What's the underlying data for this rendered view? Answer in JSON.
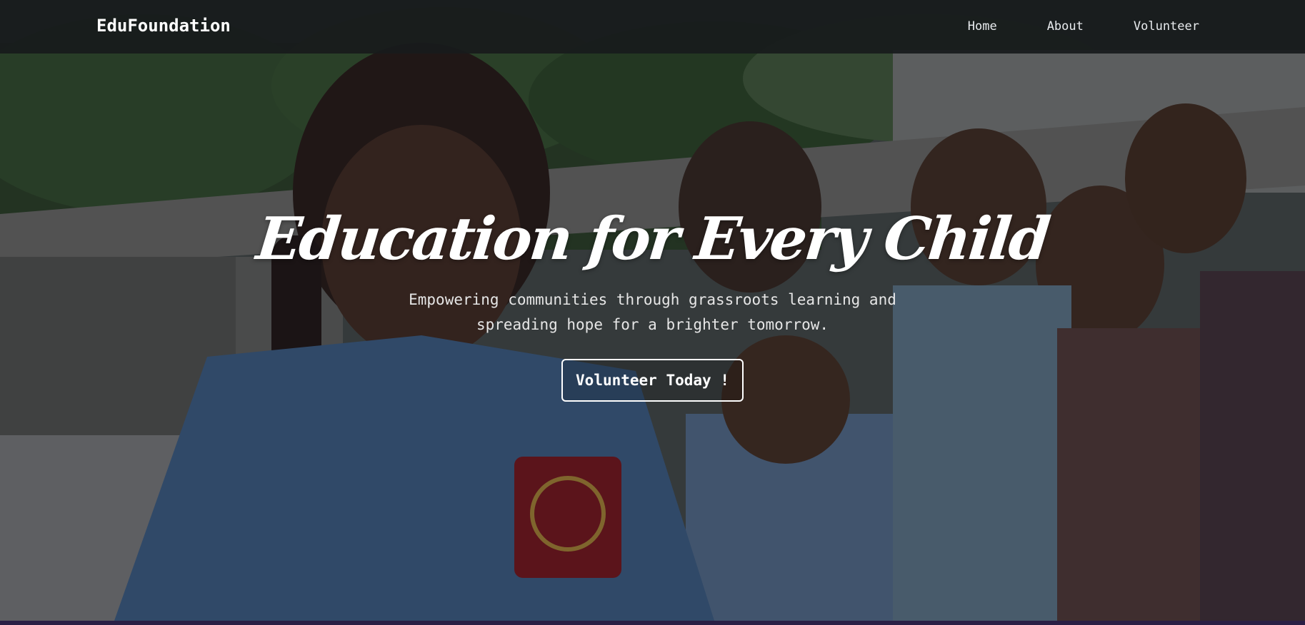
{
  "navbar": {
    "brand": "EduFoundation",
    "links": [
      "Home",
      "About",
      "Volunteer"
    ]
  },
  "hero": {
    "title": "Education for Every Child",
    "subtitle": "Empowering communities through grassroots learning and spreading hope for a brighter tomorrow.",
    "cta_label": "Volunteer Today !",
    "background_image": "photo of schoolchildren in blue checked uniforms standing in a line outdoors"
  },
  "colors": {
    "navbar_bg": "#181b1c",
    "text": "#ffffff",
    "bottom_bar": "#2a1f45"
  }
}
